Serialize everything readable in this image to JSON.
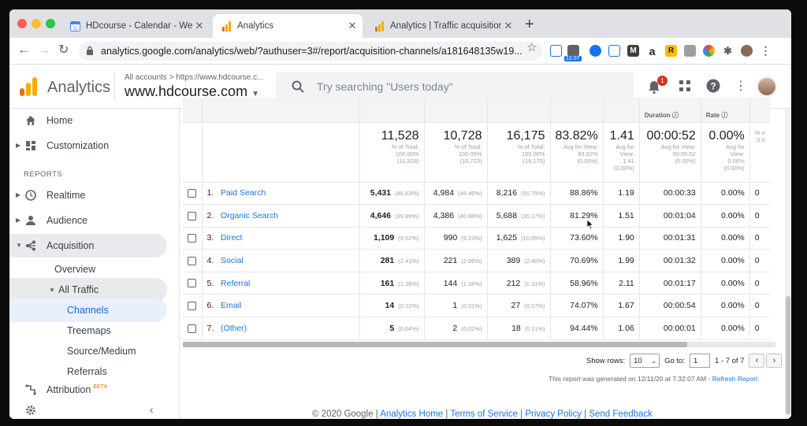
{
  "browser": {
    "tabs": [
      {
        "title": "HDcourse - Calendar - Week o",
        "active": false
      },
      {
        "title": "Analytics",
        "active": true
      },
      {
        "title": "Analytics | Traffic acquisition: T",
        "active": false
      }
    ],
    "url": "analytics.google.com/analytics/web/?authuser=3#/report/acquisition-channels/a181648135w19...",
    "extension_badge": "12.07"
  },
  "header": {
    "app_title": "Analytics",
    "account_path": "All accounts > https://www.hdcourse.c...",
    "account_name": "www.hdcourse.com",
    "search_placeholder": "Try searching \"Users today\"",
    "notification_count": "1"
  },
  "sidebar": {
    "reports_label": "REPORTS",
    "items": [
      {
        "label": "Home"
      },
      {
        "label": "Customization"
      },
      {
        "label": "Realtime"
      },
      {
        "label": "Audience"
      },
      {
        "label": "Acquisition"
      },
      {
        "label": "Overview"
      },
      {
        "label": "All Traffic"
      },
      {
        "label": "Channels"
      },
      {
        "label": "Treemaps"
      },
      {
        "label": "Source/Medium"
      },
      {
        "label": "Referrals"
      },
      {
        "label": "Attribution",
        "badge": "BETA"
      }
    ]
  },
  "table": {
    "header_partial": [
      "Duration",
      "Rate"
    ],
    "totals": [
      {
        "value": "11,528",
        "sub": [
          "% of Total:",
          "100.00%",
          "(11,528)"
        ]
      },
      {
        "value": "10,728",
        "sub": [
          "% of Total:",
          "100.05%",
          "(10,723)"
        ]
      },
      {
        "value": "16,175",
        "sub": [
          "% of Total:",
          "100.00%",
          "(16,175)"
        ]
      },
      {
        "value": "83.82%",
        "sub": [
          "Avg for View:",
          "83.82%",
          "(0.00%)"
        ]
      },
      {
        "value": "1.41",
        "sub": [
          "Avg for",
          "View:",
          "1.41",
          "(0.00%)"
        ]
      },
      {
        "value": "00:00:52",
        "sub": [
          "Avg for View:",
          "00:00:52",
          "(0.00%)"
        ]
      },
      {
        "value": "0.00%",
        "sub": [
          "Avg for",
          "View:",
          "0.00%",
          "(0.00%)"
        ]
      },
      {
        "value": "",
        "sub": [
          "% o",
          "0.0"
        ]
      }
    ],
    "rows": [
      {
        "n": "1.",
        "channel": "Paid Search",
        "users": "5,431",
        "users_pct": "(46.63%)",
        "new_users": "4,984",
        "new_users_pct": "(46.46%)",
        "sessions": "8,216",
        "sessions_pct": "(50.79%)",
        "bounce": "88.86%",
        "pages": "1.19",
        "duration": "00:00:33",
        "conv": "0.00%",
        "last": "0"
      },
      {
        "n": "2.",
        "channel": "Organic Search",
        "users": "4,646",
        "users_pct": "(39.89%)",
        "new_users": "4,386",
        "new_users_pct": "(40.88%)",
        "sessions": "5,688",
        "sessions_pct": "(35.17%)",
        "bounce": "81.29%",
        "pages": "1.51",
        "duration": "00:01:04",
        "conv": "0.00%",
        "last": "0"
      },
      {
        "n": "3.",
        "channel": "Direct",
        "users": "1,109",
        "users_pct": "(9.52%)",
        "new_users": "990",
        "new_users_pct": "(9.23%)",
        "sessions": "1,625",
        "sessions_pct": "(10.05%)",
        "bounce": "73.60%",
        "pages": "1.90",
        "duration": "00:01:31",
        "conv": "0.00%",
        "last": "0"
      },
      {
        "n": "4.",
        "channel": "Social",
        "users": "281",
        "users_pct": "(2.41%)",
        "new_users": "221",
        "new_users_pct": "(2.06%)",
        "sessions": "389",
        "sessions_pct": "(2.40%)",
        "bounce": "70.69%",
        "pages": "1.99",
        "duration": "00:01:32",
        "conv": "0.00%",
        "last": "0"
      },
      {
        "n": "5.",
        "channel": "Referral",
        "users": "161",
        "users_pct": "(1.38%)",
        "new_users": "144",
        "new_users_pct": "(1.34%)",
        "sessions": "212",
        "sessions_pct": "(1.31%)",
        "bounce": "58.96%",
        "pages": "2.11",
        "duration": "00:01:17",
        "conv": "0.00%",
        "last": "0"
      },
      {
        "n": "6.",
        "channel": "Email",
        "users": "14",
        "users_pct": "(0.12%)",
        "new_users": "1",
        "new_users_pct": "(0.01%)",
        "sessions": "27",
        "sessions_pct": "(0.17%)",
        "bounce": "74.07%",
        "pages": "1.67",
        "duration": "00:00:54",
        "conv": "0.00%",
        "last": "0"
      },
      {
        "n": "7.",
        "channel": "(Other)",
        "users": "5",
        "users_pct": "(0.04%)",
        "new_users": "2",
        "new_users_pct": "(0.02%)",
        "sessions": "18",
        "sessions_pct": "(0.11%)",
        "bounce": "94.44%",
        "pages": "1.06",
        "duration": "00:00:01",
        "conv": "0.00%",
        "last": "0"
      }
    ]
  },
  "pagination": {
    "show_rows_label": "Show rows:",
    "show_rows_value": "10",
    "goto_label": "Go to:",
    "goto_value": "1",
    "range": "1 - 7 of 7"
  },
  "generated": {
    "text": "This report was generated on 12/11/20 at 7:32:07 AM - ",
    "refresh": "Refresh Report"
  },
  "footer": {
    "copyright": "© 2020 Google | ",
    "links": [
      "Analytics Home",
      "Terms of Service",
      "Privacy Policy",
      "Send Feedback"
    ]
  },
  "colors": {
    "accent": "#1a73e8",
    "brand_orange": "#f9ab00",
    "brand_dark_orange": "#e37400"
  }
}
